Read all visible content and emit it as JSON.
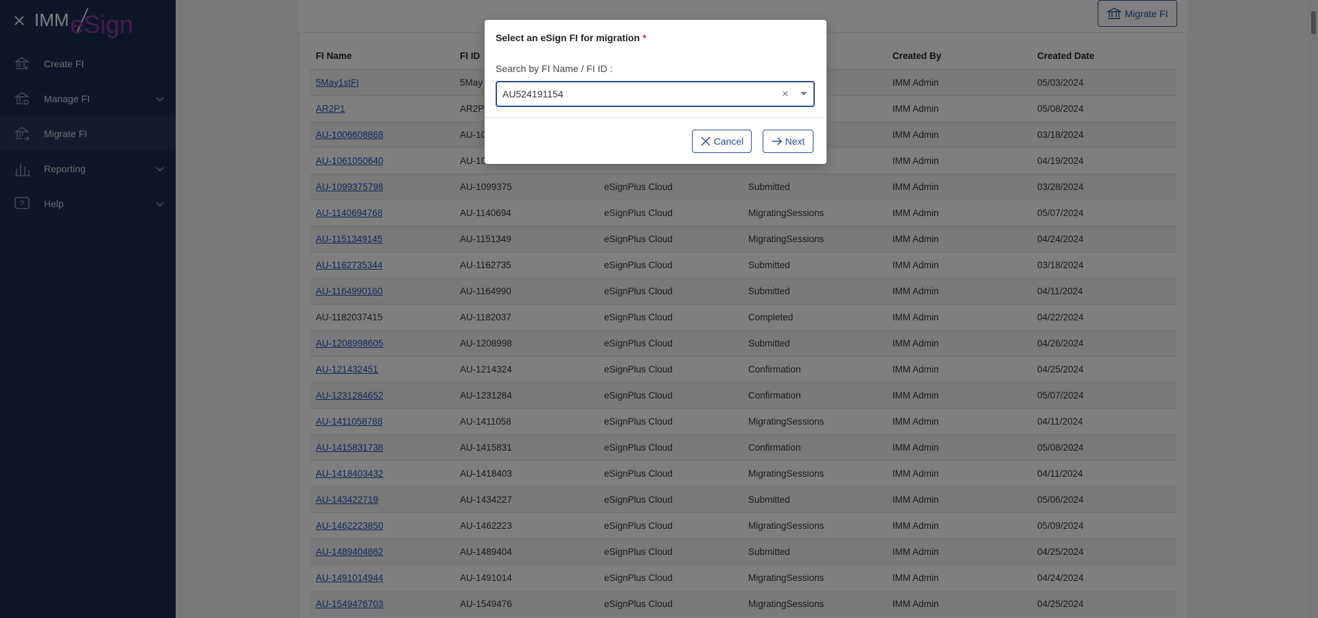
{
  "sidebar": {
    "logo_text": "IMM/eSign",
    "items": [
      {
        "label": "Create FI",
        "icon": "bank-plus-icon",
        "expandable": false
      },
      {
        "label": "Manage FI",
        "icon": "bank-gear-icon",
        "expandable": true
      },
      {
        "label": "Migrate FI",
        "icon": "bank-migrate-icon",
        "expandable": false,
        "active": true
      },
      {
        "label": "Reporting",
        "icon": "bar-chart-icon",
        "expandable": true
      },
      {
        "label": "Help",
        "icon": "help-icon",
        "expandable": true
      }
    ]
  },
  "toolbar": {
    "migrate_label": "Migrate FI"
  },
  "table": {
    "columns": [
      "FI Name",
      "FI ID",
      "",
      "",
      "Created By",
      "Created Date"
    ],
    "rows": [
      {
        "name": "5May1stFI",
        "link": true,
        "id": "5May",
        "platform": "",
        "status": "",
        "by": "IMM Admin",
        "date": "05/03/2024"
      },
      {
        "name": "AR2P1",
        "link": true,
        "id": "AR2P",
        "platform": "",
        "status": "",
        "by": "IMM Admin",
        "date": "05/08/2024"
      },
      {
        "name": "AU-1006608868",
        "link": true,
        "id": "AU-10",
        "platform": "",
        "status": "",
        "by": "IMM Admin",
        "date": "03/18/2024"
      },
      {
        "name": "AU-1061050640",
        "link": true,
        "id": "AU-10",
        "platform": "",
        "status": "",
        "by": "IMM Admin",
        "date": "04/19/2024"
      },
      {
        "name": "AU-1099375798",
        "link": true,
        "id": "AU-1099375",
        "platform": "eSignPlus Cloud",
        "status": "Submitted",
        "by": "IMM Admin",
        "date": "03/28/2024"
      },
      {
        "name": "AU-1140694768",
        "link": true,
        "id": "AU-1140694",
        "platform": "eSignPlus Cloud",
        "status": "MigratingSessions",
        "by": "IMM Admin",
        "date": "05/07/2024"
      },
      {
        "name": "AU-1151349145",
        "link": true,
        "id": "AU-1151349",
        "platform": "eSignPlus Cloud",
        "status": "MigratingSessions",
        "by": "IMM Admin",
        "date": "04/24/2024"
      },
      {
        "name": "AU-1162735344",
        "link": true,
        "id": "AU-1162735",
        "platform": "eSignPlus Cloud",
        "status": "Submitted",
        "by": "IMM Admin",
        "date": "03/18/2024"
      },
      {
        "name": "AU-1164990160",
        "link": true,
        "id": "AU-1164990",
        "platform": "eSignPlus Cloud",
        "status": "Submitted",
        "by": "IMM Admin",
        "date": "04/11/2024"
      },
      {
        "name": "AU-1182037415",
        "link": false,
        "id": "AU-1182037",
        "platform": "eSignPlus Cloud",
        "status": "Completed",
        "by": "IMM Admin",
        "date": "04/22/2024"
      },
      {
        "name": "AU-1208998605",
        "link": true,
        "id": "AU-1208998",
        "platform": "eSignPlus Cloud",
        "status": "Submitted",
        "by": "IMM Admin",
        "date": "04/26/2024"
      },
      {
        "name": "AU-121432451",
        "link": true,
        "id": "AU-1214324",
        "platform": "eSignPlus Cloud",
        "status": "Confirmation",
        "by": "IMM Admin",
        "date": "04/25/2024"
      },
      {
        "name": "AU-1231284652",
        "link": true,
        "id": "AU-1231284",
        "platform": "eSignPlus Cloud",
        "status": "Confirmation",
        "by": "IMM Admin",
        "date": "05/07/2024"
      },
      {
        "name": "AU-1411058788",
        "link": true,
        "id": "AU-1411058",
        "platform": "eSignPlus Cloud",
        "status": "MigratingSessions",
        "by": "IMM Admin",
        "date": "04/11/2024"
      },
      {
        "name": "AU-1415831738",
        "link": true,
        "id": "AU-1415831",
        "platform": "eSignPlus Cloud",
        "status": "Confirmation",
        "by": "IMM Admin",
        "date": "05/08/2024"
      },
      {
        "name": "AU-1418403432",
        "link": true,
        "id": "AU-1418403",
        "platform": "eSignPlus Cloud",
        "status": "MigratingSessions",
        "by": "IMM Admin",
        "date": "04/11/2024"
      },
      {
        "name": "AU-143422719",
        "link": true,
        "id": "AU-1434227",
        "platform": "eSignPlus Cloud",
        "status": "Submitted",
        "by": "IMM Admin",
        "date": "05/06/2024"
      },
      {
        "name": "AU-1462223850",
        "link": true,
        "id": "AU-1462223",
        "platform": "eSignPlus Cloud",
        "status": "MigratingSessions",
        "by": "IMM Admin",
        "date": "05/09/2024"
      },
      {
        "name": "AU-1489404862",
        "link": true,
        "id": "AU-1489404",
        "platform": "eSignPlus Cloud",
        "status": "Submitted",
        "by": "IMM Admin",
        "date": "04/25/2024"
      },
      {
        "name": "AU-1491014944",
        "link": true,
        "id": "AU-1491014",
        "platform": "eSignPlus Cloud",
        "status": "MigratingSessions",
        "by": "IMM Admin",
        "date": "04/24/2024"
      },
      {
        "name": "AU-1549476703",
        "link": true,
        "id": "AU-1549476",
        "platform": "eSignPlus Cloud",
        "status": "MigratingSessions",
        "by": "IMM Admin",
        "date": "04/25/2024"
      }
    ]
  },
  "modal": {
    "title": "Select an eSign FI for migration",
    "required_mark": "*",
    "search_label": "Search by FI Name / FI ID :",
    "selected_value": "AU524191154",
    "clear_glyph": "×",
    "cancel_label": "Cancel",
    "next_label": "Next"
  },
  "colors": {
    "sidebar_bg": "#1c2d54",
    "accent": "#2b4d8f",
    "link": "#1f4fb0",
    "required": "#d9263b"
  }
}
